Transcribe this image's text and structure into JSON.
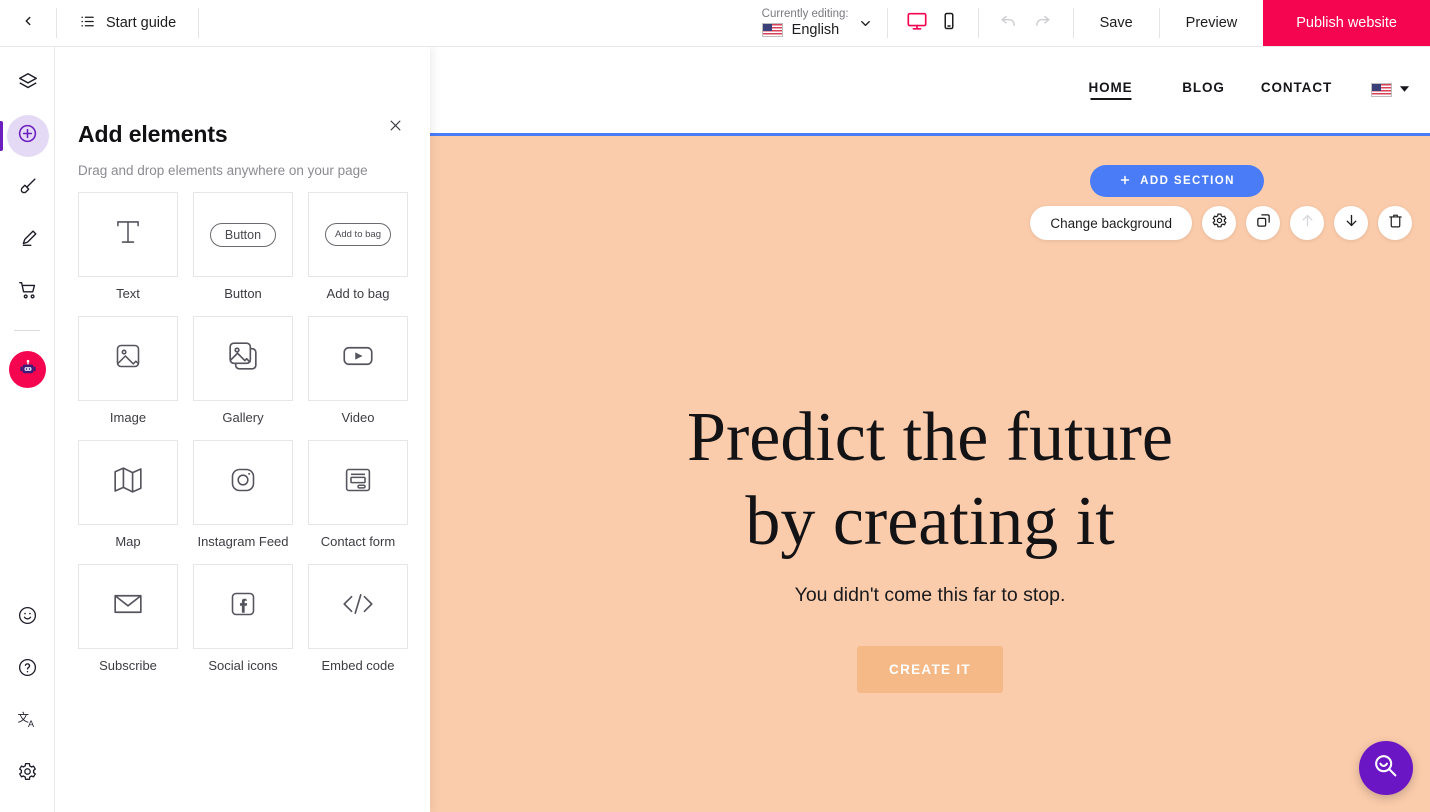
{
  "topbar": {
    "back_icon": "chevron-left-icon",
    "guide_icon": "list-icon",
    "guide_label": "Start guide",
    "lang_caption": "Currently editing:",
    "lang_value": "English",
    "lang_chevron_icon": "chevron-down-icon",
    "device_desktop_icon": "monitor-icon",
    "device_mobile_icon": "mobile-icon",
    "undo_icon": "undo-arrow-icon",
    "redo_icon": "redo-arrow-icon",
    "save_label": "Save",
    "preview_label": "Preview",
    "publish_label": "Publish website",
    "publish_color": "#F5054F",
    "active_device_color": "#F5054F"
  },
  "rail": {
    "items": [
      {
        "name": "layers",
        "icon": "layers-icon",
        "active": false
      },
      {
        "name": "add-elements",
        "icon": "plus-circle-icon",
        "active": true
      },
      {
        "name": "design",
        "icon": "paintbrush-icon",
        "active": false
      },
      {
        "name": "edit",
        "icon": "pen-icon",
        "active": false
      },
      {
        "name": "store",
        "icon": "shopping-cart-icon",
        "active": false
      },
      {
        "name": "assistant",
        "icon": "robot-icon",
        "active": false
      }
    ],
    "bottom_items": [
      {
        "name": "feedback",
        "icon": "smiley-icon"
      },
      {
        "name": "help",
        "icon": "question-circle-icon"
      },
      {
        "name": "translate",
        "icon": "translate-icon"
      },
      {
        "name": "settings",
        "icon": "gear-icon"
      }
    ],
    "active_bg": "#E4DAF5",
    "active_accent": "#6B1FBF",
    "robot_bg": "#F5054F"
  },
  "panel": {
    "title": "Add elements",
    "subtitle": "Drag and drop elements anywhere on your page",
    "close_icon": "close-icon",
    "elements": [
      {
        "label": "Text",
        "icon": "text-t-icon"
      },
      {
        "label": "Button",
        "icon": "button-pill-icon",
        "pill_text": "Button"
      },
      {
        "label": "Add to bag",
        "icon": "add-to-bag-pill-icon",
        "pill_text": "Add to bag"
      },
      {
        "label": "Image",
        "icon": "image-icon"
      },
      {
        "label": "Gallery",
        "icon": "gallery-icon"
      },
      {
        "label": "Video",
        "icon": "video-play-icon"
      },
      {
        "label": "Map",
        "icon": "map-icon"
      },
      {
        "label": "Instagram Feed",
        "icon": "instagram-icon"
      },
      {
        "label": "Contact form",
        "icon": "contact-form-icon"
      },
      {
        "label": "Subscribe",
        "icon": "envelope-icon"
      },
      {
        "label": "Social icons",
        "icon": "facebook-icon"
      },
      {
        "label": "Embed code",
        "icon": "code-brackets-icon"
      }
    ]
  },
  "canvas": {
    "nav": {
      "links": [
        {
          "label": "HOME",
          "active": true
        },
        {
          "label": "BLOG",
          "active": false
        },
        {
          "label": "CONTACT",
          "active": false
        }
      ],
      "flag_icon": "us-flag-icon",
      "flag_chevron_icon": "caret-down-icon"
    },
    "add_section_label": "ADD SECTION",
    "add_section_icon": "plus-icon",
    "add_section_color": "#4A7CF8",
    "section_toolbar": {
      "change_background_label": "Change background",
      "settings_icon": "gear-icon",
      "duplicate_icon": "copy-icon",
      "move_up_icon": "arrow-up-icon",
      "move_down_icon": "arrow-down-icon",
      "delete_icon": "trash-icon"
    },
    "hero": {
      "background_color": "#FBCCAC",
      "heading_line1": "Predict the future",
      "heading_line2": "by creating it",
      "subheading": "You didn't come this far to stop.",
      "cta_label": "CREATE IT",
      "cta_color": "#F5B887"
    }
  },
  "fab": {
    "icon": "search-smile-icon",
    "color": "#6B16C4"
  }
}
